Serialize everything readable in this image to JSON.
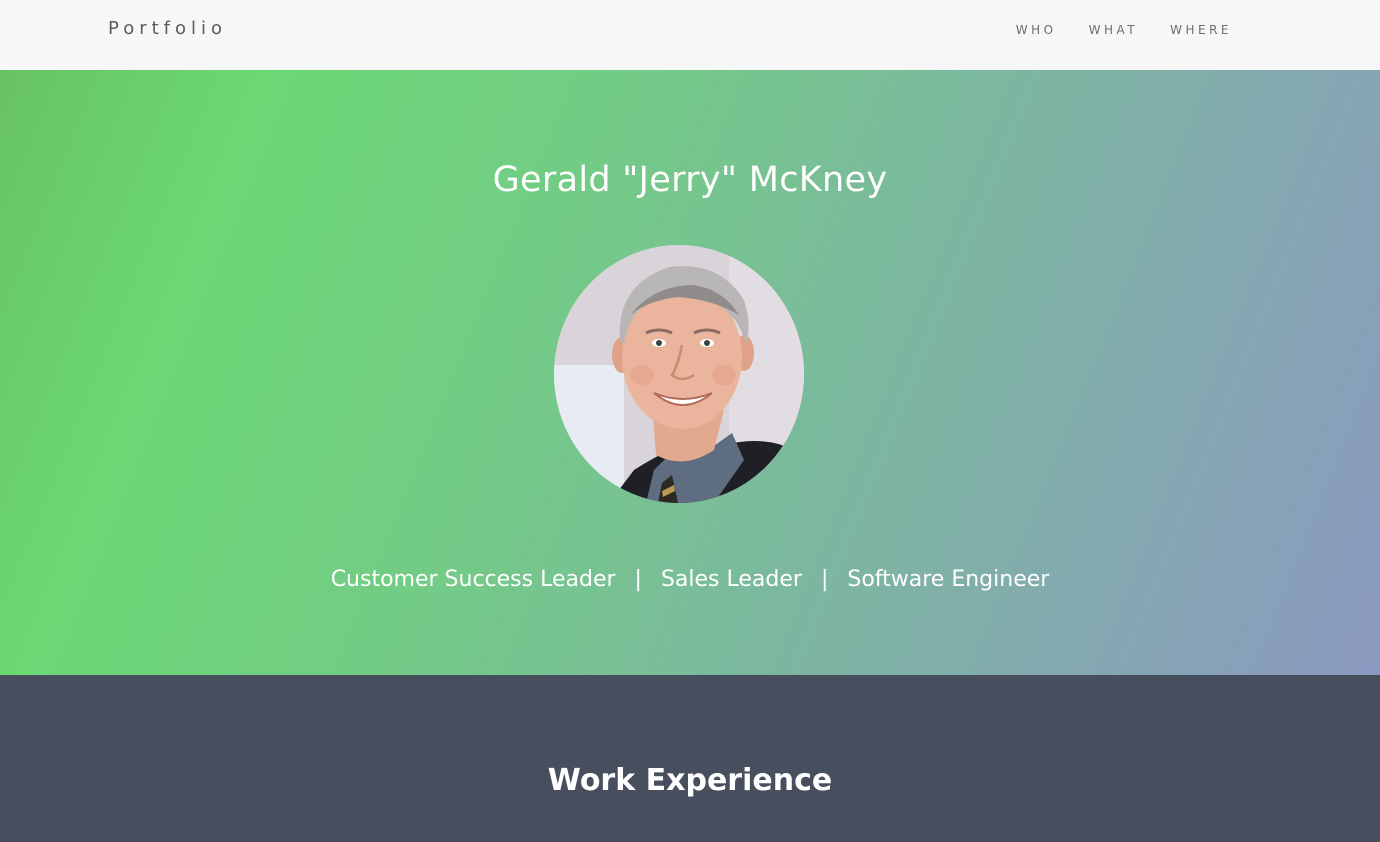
{
  "navbar": {
    "brand": "Portfolio",
    "links": [
      {
        "label": "WHO"
      },
      {
        "label": "WHAT"
      },
      {
        "label": "WHERE"
      }
    ]
  },
  "hero": {
    "name": "Gerald \"Jerry\" McKney",
    "roles": [
      "Customer Success Leader",
      "Sales Leader",
      "Software Engineer"
    ],
    "separator": "|"
  },
  "work": {
    "title": "Work Experience"
  },
  "colors": {
    "navbar_bg": "#f7f7f7",
    "gradient_start": "#6bd874",
    "gradient_end": "#8b99c0",
    "section_dark": "#474e5e"
  }
}
